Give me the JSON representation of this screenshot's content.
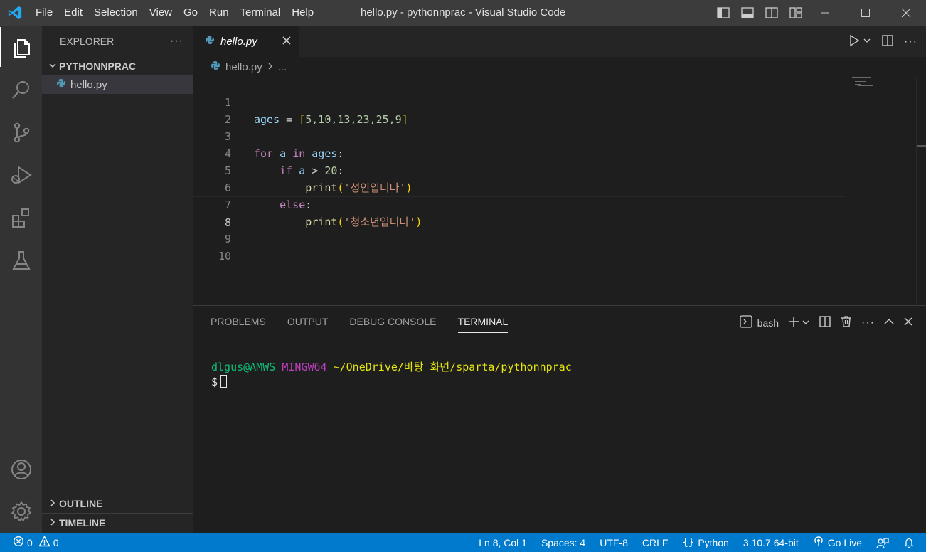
{
  "window": {
    "title": "hello.py - pythonnprac - Visual Studio Code",
    "menu": [
      "File",
      "Edit",
      "Selection",
      "View",
      "Go",
      "Run",
      "Terminal",
      "Help"
    ]
  },
  "sidebar": {
    "header": "EXPLORER",
    "more": "···",
    "folder": "PYTHONNPRAC",
    "files": [
      "hello.py"
    ],
    "sections": [
      "OUTLINE",
      "TIMELINE"
    ]
  },
  "editor": {
    "tab_label": "hello.py",
    "breadcrumb": {
      "file": "hello.py",
      "rest": "..."
    },
    "line_numbers": [
      "1",
      "2",
      "3",
      "4",
      "5",
      "6",
      "7",
      "8",
      "9",
      "10"
    ],
    "current_line": 8,
    "code": {
      "l1": {
        "var": "ages",
        "eq": " = ",
        "open": "[",
        "nums": "5,10,13,23,25,9",
        "close": "]"
      },
      "l3": {
        "kw_for": "for",
        "var_a": "a",
        "kw_in": "in",
        "var_ages": "ages",
        "colon": ":"
      },
      "l4": {
        "kw_if": "if",
        "var_a": "a",
        "op": " > ",
        "num": "20",
        "colon": ":"
      },
      "l5": {
        "fn": "print",
        "open": "(",
        "str": "'성인입니다'",
        "close": ")"
      },
      "l6": {
        "kw_else": "else",
        "colon": ":"
      },
      "l7": {
        "fn": "print",
        "open": "(",
        "str": "'청소년입니다'",
        "close": ")"
      }
    }
  },
  "panel": {
    "tabs": [
      "PROBLEMS",
      "OUTPUT",
      "DEBUG CONSOLE",
      "TERMINAL"
    ],
    "active_tab": "TERMINAL",
    "shell": "bash",
    "terminal": {
      "user": "dlgus@AMWS",
      "host": "MINGW64",
      "path": "~/OneDrive/바탕 화면/sparta/pythonnprac",
      "prompt": "$"
    }
  },
  "statusbar": {
    "errors": "0",
    "warnings": "0",
    "position": "Ln 8, Col 1",
    "spaces": "Spaces: 4",
    "encoding": "UTF-8",
    "eol": "CRLF",
    "language": "Python",
    "interpreter": "3.10.7 64-bit",
    "live": "Go Live"
  },
  "colors": {
    "accent": "#007acc",
    "titlebar": "#3c3c3c",
    "activitybar": "#333333",
    "sidebar": "#252526",
    "editor": "#1e1e1e"
  },
  "icons": {
    "activity": [
      "files-icon",
      "search-icon",
      "source-control-icon",
      "run-debug-icon",
      "extensions-icon",
      "testing-icon",
      "account-icon",
      "settings-gear-icon"
    ]
  }
}
